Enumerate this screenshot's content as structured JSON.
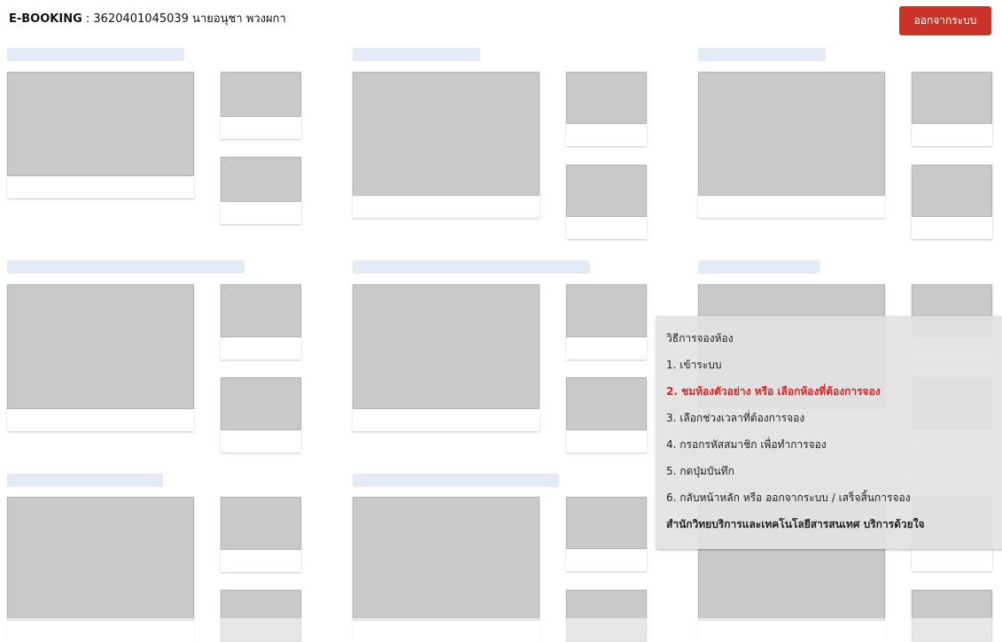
{
  "header": {
    "brand": "E-BOOKING",
    "separator": " : ",
    "user": "3620401045039 นายอนุชา พวงผกา",
    "logout_label": "ออกจากระบบ"
  },
  "info_panel": {
    "title": "วิธีการจองห้อง",
    "steps": [
      "1. เข้าระบบ",
      "2. ชมห้องตัวอย่าง หรือ เลือกห้องที่ต้องการจอง",
      "3. เลือกช่วงเวลาที่ต้องการจอง",
      "4. กรอกรหัสสมาชิก เพื่อทำการจอง",
      "5. กดปุ่มบันทึก",
      "6. กลับหน้าหลัก หรือ ออกจากระบบ / เสร็จสิ้นการจอง"
    ],
    "footer": "สำนักวิทยบริการและเทคโนโลยีสารสนเทศ บริการด้วยใจ"
  }
}
